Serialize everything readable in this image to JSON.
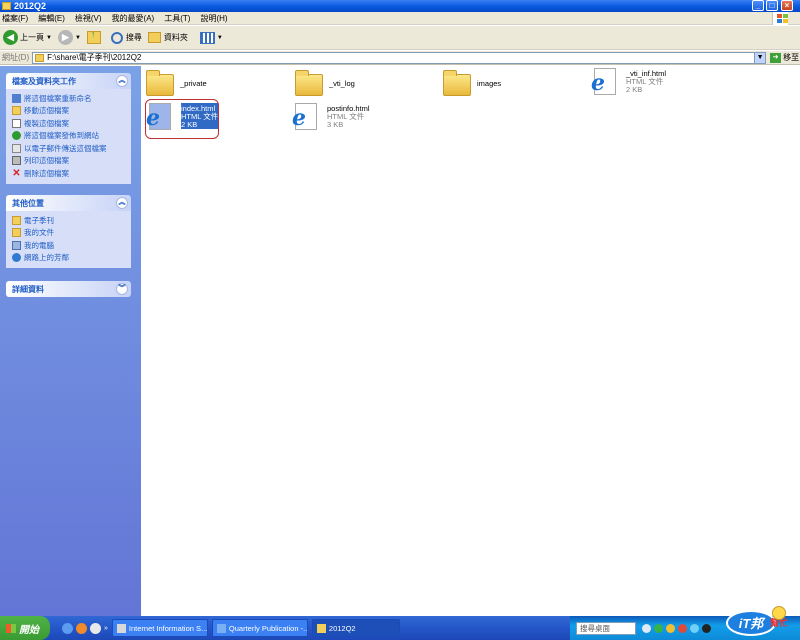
{
  "window": {
    "title": "2012Q2"
  },
  "menu": [
    "檔案(F)",
    "編輯(E)",
    "檢視(V)",
    "我的最愛(A)",
    "工具(T)",
    "說明(H)"
  ],
  "toolbar": {
    "back": "上一頁",
    "search": "搜尋",
    "folders": "資料夾"
  },
  "address": {
    "label": "網址(D)",
    "path": "F:\\share\\電子季刊\\2012Q2",
    "go": "移至"
  },
  "tasks_panel": {
    "title": "檔案及資料夾工作",
    "items": [
      "將這個檔案重新命名",
      "移動這個檔案",
      "複製這個檔案",
      "將這個檔案發佈到網站",
      "以電子郵件傳送這個檔案",
      "列印這個檔案",
      "刪除這個檔案"
    ]
  },
  "places_panel": {
    "title": "其他位置",
    "items": [
      "電子季刊",
      "我的文件",
      "我的電腦",
      "網路上的芳鄰"
    ]
  },
  "details_panel": {
    "title": "詳細資料"
  },
  "files": [
    {
      "name": "_private",
      "type": "folder"
    },
    {
      "name": "_vti_log",
      "type": "folder"
    },
    {
      "name": "images",
      "type": "folder"
    },
    {
      "name": "_vti_inf.html",
      "kind": "HTML 文件",
      "size": "2 KB",
      "type": "html"
    },
    {
      "name": "index.html",
      "kind": "HTML 文件",
      "size": "2 KB",
      "type": "html",
      "selected": true
    },
    {
      "name": "postinfo.html",
      "kind": "HTML 文件",
      "size": "3 KB",
      "type": "html"
    }
  ],
  "taskbar": {
    "start": "開始",
    "tasks": [
      "Internet Information S...",
      "Quarterly Publication -...",
      "2012Q2"
    ],
    "search": "搜尋桌面"
  },
  "logo": {
    "text": "iT邦",
    "sub": "幫忙"
  }
}
